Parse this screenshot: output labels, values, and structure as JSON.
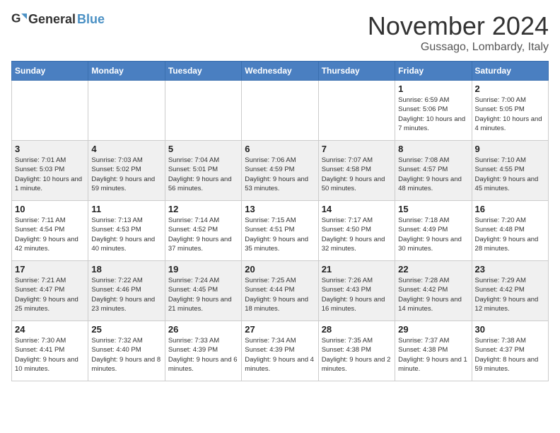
{
  "header": {
    "logo_general": "General",
    "logo_blue": "Blue",
    "month": "November 2024",
    "location": "Gussago, Lombardy, Italy"
  },
  "weekdays": [
    "Sunday",
    "Monday",
    "Tuesday",
    "Wednesday",
    "Thursday",
    "Friday",
    "Saturday"
  ],
  "weeks": [
    [
      {
        "day": "",
        "info": ""
      },
      {
        "day": "",
        "info": ""
      },
      {
        "day": "",
        "info": ""
      },
      {
        "day": "",
        "info": ""
      },
      {
        "day": "",
        "info": ""
      },
      {
        "day": "1",
        "info": "Sunrise: 6:59 AM\nSunset: 5:06 PM\nDaylight: 10 hours\nand 7 minutes."
      },
      {
        "day": "2",
        "info": "Sunrise: 7:00 AM\nSunset: 5:05 PM\nDaylight: 10 hours\nand 4 minutes."
      }
    ],
    [
      {
        "day": "3",
        "info": "Sunrise: 7:01 AM\nSunset: 5:03 PM\nDaylight: 10 hours\nand 1 minute."
      },
      {
        "day": "4",
        "info": "Sunrise: 7:03 AM\nSunset: 5:02 PM\nDaylight: 9 hours\nand 59 minutes."
      },
      {
        "day": "5",
        "info": "Sunrise: 7:04 AM\nSunset: 5:01 PM\nDaylight: 9 hours\nand 56 minutes."
      },
      {
        "day": "6",
        "info": "Sunrise: 7:06 AM\nSunset: 4:59 PM\nDaylight: 9 hours\nand 53 minutes."
      },
      {
        "day": "7",
        "info": "Sunrise: 7:07 AM\nSunset: 4:58 PM\nDaylight: 9 hours\nand 50 minutes."
      },
      {
        "day": "8",
        "info": "Sunrise: 7:08 AM\nSunset: 4:57 PM\nDaylight: 9 hours\nand 48 minutes."
      },
      {
        "day": "9",
        "info": "Sunrise: 7:10 AM\nSunset: 4:55 PM\nDaylight: 9 hours\nand 45 minutes."
      }
    ],
    [
      {
        "day": "10",
        "info": "Sunrise: 7:11 AM\nSunset: 4:54 PM\nDaylight: 9 hours\nand 42 minutes."
      },
      {
        "day": "11",
        "info": "Sunrise: 7:13 AM\nSunset: 4:53 PM\nDaylight: 9 hours\nand 40 minutes."
      },
      {
        "day": "12",
        "info": "Sunrise: 7:14 AM\nSunset: 4:52 PM\nDaylight: 9 hours\nand 37 minutes."
      },
      {
        "day": "13",
        "info": "Sunrise: 7:15 AM\nSunset: 4:51 PM\nDaylight: 9 hours\nand 35 minutes."
      },
      {
        "day": "14",
        "info": "Sunrise: 7:17 AM\nSunset: 4:50 PM\nDaylight: 9 hours\nand 32 minutes."
      },
      {
        "day": "15",
        "info": "Sunrise: 7:18 AM\nSunset: 4:49 PM\nDaylight: 9 hours\nand 30 minutes."
      },
      {
        "day": "16",
        "info": "Sunrise: 7:20 AM\nSunset: 4:48 PM\nDaylight: 9 hours\nand 28 minutes."
      }
    ],
    [
      {
        "day": "17",
        "info": "Sunrise: 7:21 AM\nSunset: 4:47 PM\nDaylight: 9 hours\nand 25 minutes."
      },
      {
        "day": "18",
        "info": "Sunrise: 7:22 AM\nSunset: 4:46 PM\nDaylight: 9 hours\nand 23 minutes."
      },
      {
        "day": "19",
        "info": "Sunrise: 7:24 AM\nSunset: 4:45 PM\nDaylight: 9 hours\nand 21 minutes."
      },
      {
        "day": "20",
        "info": "Sunrise: 7:25 AM\nSunset: 4:44 PM\nDaylight: 9 hours\nand 18 minutes."
      },
      {
        "day": "21",
        "info": "Sunrise: 7:26 AM\nSunset: 4:43 PM\nDaylight: 9 hours\nand 16 minutes."
      },
      {
        "day": "22",
        "info": "Sunrise: 7:28 AM\nSunset: 4:42 PM\nDaylight: 9 hours\nand 14 minutes."
      },
      {
        "day": "23",
        "info": "Sunrise: 7:29 AM\nSunset: 4:42 PM\nDaylight: 9 hours\nand 12 minutes."
      }
    ],
    [
      {
        "day": "24",
        "info": "Sunrise: 7:30 AM\nSunset: 4:41 PM\nDaylight: 9 hours\nand 10 minutes."
      },
      {
        "day": "25",
        "info": "Sunrise: 7:32 AM\nSunset: 4:40 PM\nDaylight: 9 hours\nand 8 minutes."
      },
      {
        "day": "26",
        "info": "Sunrise: 7:33 AM\nSunset: 4:39 PM\nDaylight: 9 hours\nand 6 minutes."
      },
      {
        "day": "27",
        "info": "Sunrise: 7:34 AM\nSunset: 4:39 PM\nDaylight: 9 hours\nand 4 minutes."
      },
      {
        "day": "28",
        "info": "Sunrise: 7:35 AM\nSunset: 4:38 PM\nDaylight: 9 hours\nand 2 minutes."
      },
      {
        "day": "29",
        "info": "Sunrise: 7:37 AM\nSunset: 4:38 PM\nDaylight: 9 hours\nand 1 minute."
      },
      {
        "day": "30",
        "info": "Sunrise: 7:38 AM\nSunset: 4:37 PM\nDaylight: 8 hours\nand 59 minutes."
      }
    ]
  ]
}
